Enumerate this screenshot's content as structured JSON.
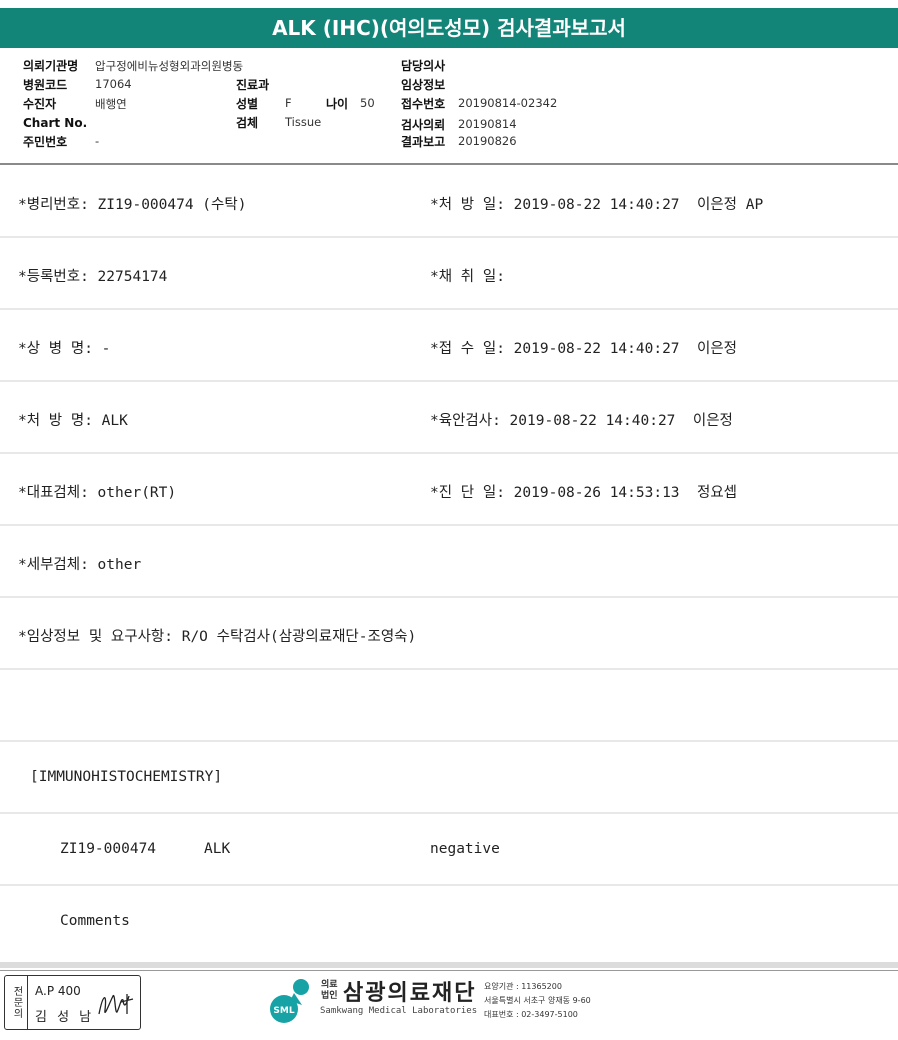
{
  "title": "ALK (IHC)(여의도성모) 검사결과보고서",
  "header": {
    "institution_label": "의뢰기관명",
    "institution_value": "압구정에비뉴성형외과의원병동",
    "hospital_code_label": "병원코드",
    "hospital_code_value": "17064",
    "examinee_label": "수진자",
    "examinee_value": "배행연",
    "chart_no_label": "Chart No.",
    "resident_no_label": "주민번호",
    "resident_no_value": "-",
    "dept_label": "진료과",
    "sex_label": "성별",
    "sex_value": "F",
    "age_label": "나이",
    "age_value": "50",
    "specimen_label": "검체",
    "specimen_value": "Tissue",
    "doctor_label": "담당의사",
    "clinical_info_label": "임상정보",
    "receipt_no_label": "접수번호",
    "receipt_no_value": "20190814-02342",
    "request_label": "검사의뢰",
    "request_value": "20190814",
    "report_label": "결과보고",
    "report_value": "20190826"
  },
  "rows": {
    "pathology_no": "*병리번호: ZI19-000474 (수탁)",
    "prescription_date": "*처 방 일: 2019-08-22 14:40:27  이은정 AP",
    "registration_no": "*등록번호: 22754174",
    "collection_date": "*채 취 일:",
    "disease_name": "*상 병 명: -",
    "receipt_date": "*접 수 일: 2019-08-22 14:40:27  이은정",
    "prescription_name": "*처 방 명: ALK",
    "gross_exam": "*육안검사: 2019-08-22 14:40:27  이은정",
    "main_specimen": "*대표검체: other(RT)",
    "diagnosis_date": "*진 단 일: 2019-08-26 14:53:13  정요셉",
    "detail_specimen": "*세부검체: other",
    "clinical_request": "*임상정보 및 요구사항: R/O 수탁검사(삼광의료재단-조영숙)",
    "section_header": "[IMMUNOHISTOCHEMISTRY]",
    "result_id": "ZI19-000474",
    "result_marker": "ALK",
    "result_value": "negative",
    "comments": "Comments"
  },
  "footer": {
    "stamp_side": "전문의",
    "stamp_ap": "A.P 400",
    "stamp_name": "김 성 남",
    "org_small_1": "의료",
    "org_small_2": "법인",
    "org_name": "삼광의료재단",
    "org_en": "Samkwang Medical Laboratories",
    "logo_text": "SML",
    "org_info_1": "요양기관 : 11365200",
    "org_info_2": "서울특별시 서초구 양재동 9-60",
    "org_info_3": "대표번호 : 02-3497-5100"
  },
  "colors": {
    "title_bar": "#138478",
    "logo_teal": "#17a3a5"
  }
}
